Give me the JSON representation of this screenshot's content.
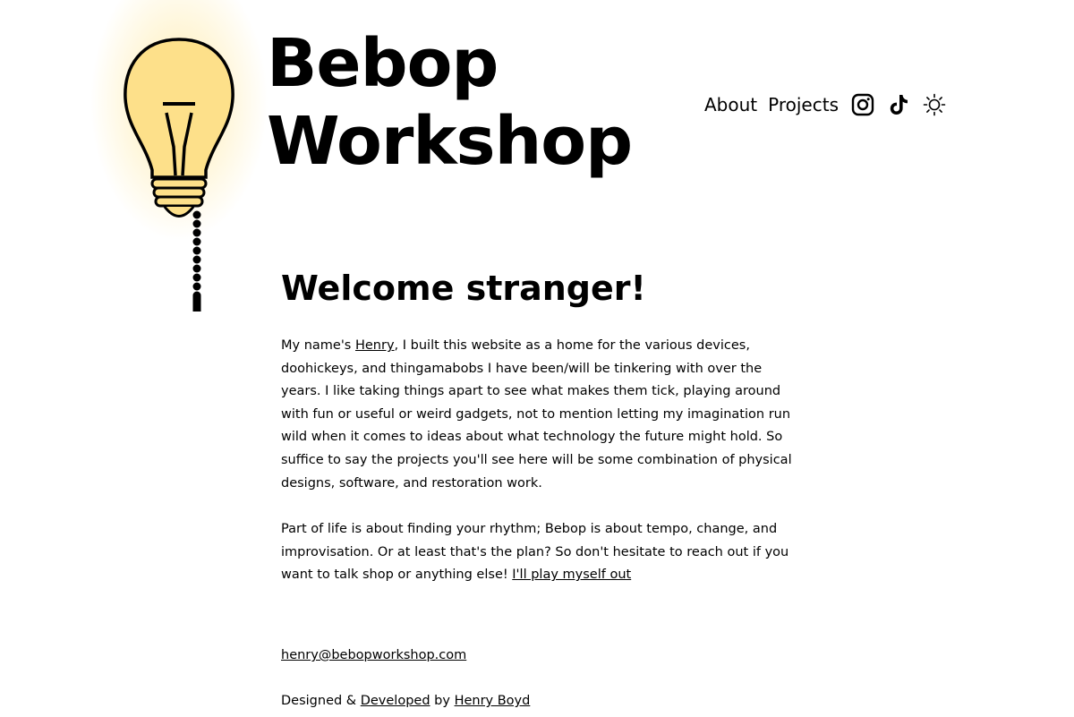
{
  "header": {
    "title_line1": "Bebop",
    "title_line2": "Workshop"
  },
  "nav": {
    "about": "About",
    "projects": "Projects",
    "icons": [
      "instagram-icon",
      "tiktok-icon",
      "sun-icon"
    ]
  },
  "main": {
    "heading": "Welcome stranger!",
    "p1_before": "My name's ",
    "p1_link": "Henry",
    "p1_after": ", I built this website as a home for the various devices, doohickeys, and thingamabobs I have been/will be tinkering with over the years. I like taking things apart to see what makes them tick, playing around with fun or useful or weird gadgets, not to mention letting my imagination run wild when it comes to ideas about what technology the future might hold. So suffice to say the projects you'll see here will be some combination of physical designs, software, and restoration work.",
    "p2_text": "Part of life is about finding your rhythm; Bebop is about tempo, change, and improvisation. Or at least that's the plan? So don't hesitate to reach out if you want to talk shop or anything else! ",
    "p2_link": "I'll play myself out"
  },
  "footer": {
    "email": "henry@bebopworkshop.com",
    "designed": "Designed & ",
    "developed_link": "Developed",
    "by": " by ",
    "author_link": "Henry Boyd"
  },
  "colors": {
    "bulb_fill": "#fde08a",
    "glow": "#ffd65a",
    "text": "#000000",
    "background": "#ffffff"
  }
}
